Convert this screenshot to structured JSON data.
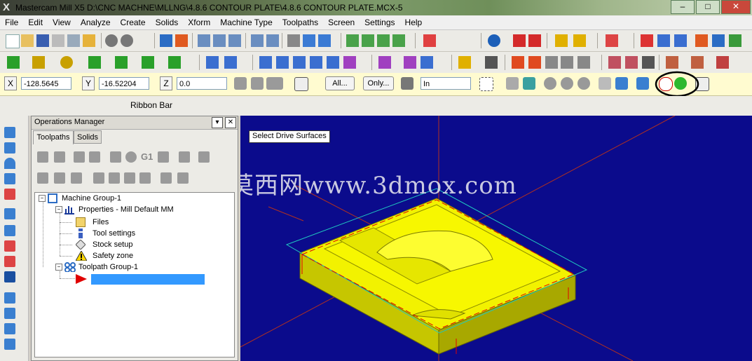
{
  "window": {
    "title": "Mastercam Mill X5  D:\\CNC MACHNE\\MLLNG\\4.8.6 CONTOUR PLATE\\4.8.6 CONTOUR PLATE.MCX-5"
  },
  "menu": {
    "items": [
      "File",
      "Edit",
      "View",
      "Analyze",
      "Create",
      "Solids",
      "Xform",
      "Machine Type",
      "Toolpaths",
      "Screen",
      "Settings",
      "Help"
    ]
  },
  "ribbon": {
    "x_label": "X",
    "x_value": "-128.5645",
    "y_label": "Y",
    "y_value": "-16.52204",
    "z_label": "Z",
    "z_value": "0.0",
    "all_button": "All...",
    "only_button": "Only...",
    "mode_value": "In",
    "bar_label": "Ribbon Bar"
  },
  "ops_manager": {
    "title": "Operations Manager",
    "tabs": [
      "Toolpaths",
      "Solids"
    ],
    "g1_label": "G1",
    "tree": {
      "machine_group": "Machine Group-1",
      "properties": "Properties - Mill Default MM",
      "files": "Files",
      "tool_settings": "Tool settings",
      "stock_setup": "Stock setup",
      "safety_zone": "Safety zone",
      "toolpath_group": "Toolpath Group-1"
    }
  },
  "viewport": {
    "tooltip": "Select Drive Surfaces",
    "watermark": "莫西网www.3dmox.com",
    "background": "#0b0b8c",
    "part_color": "#f0f000"
  }
}
